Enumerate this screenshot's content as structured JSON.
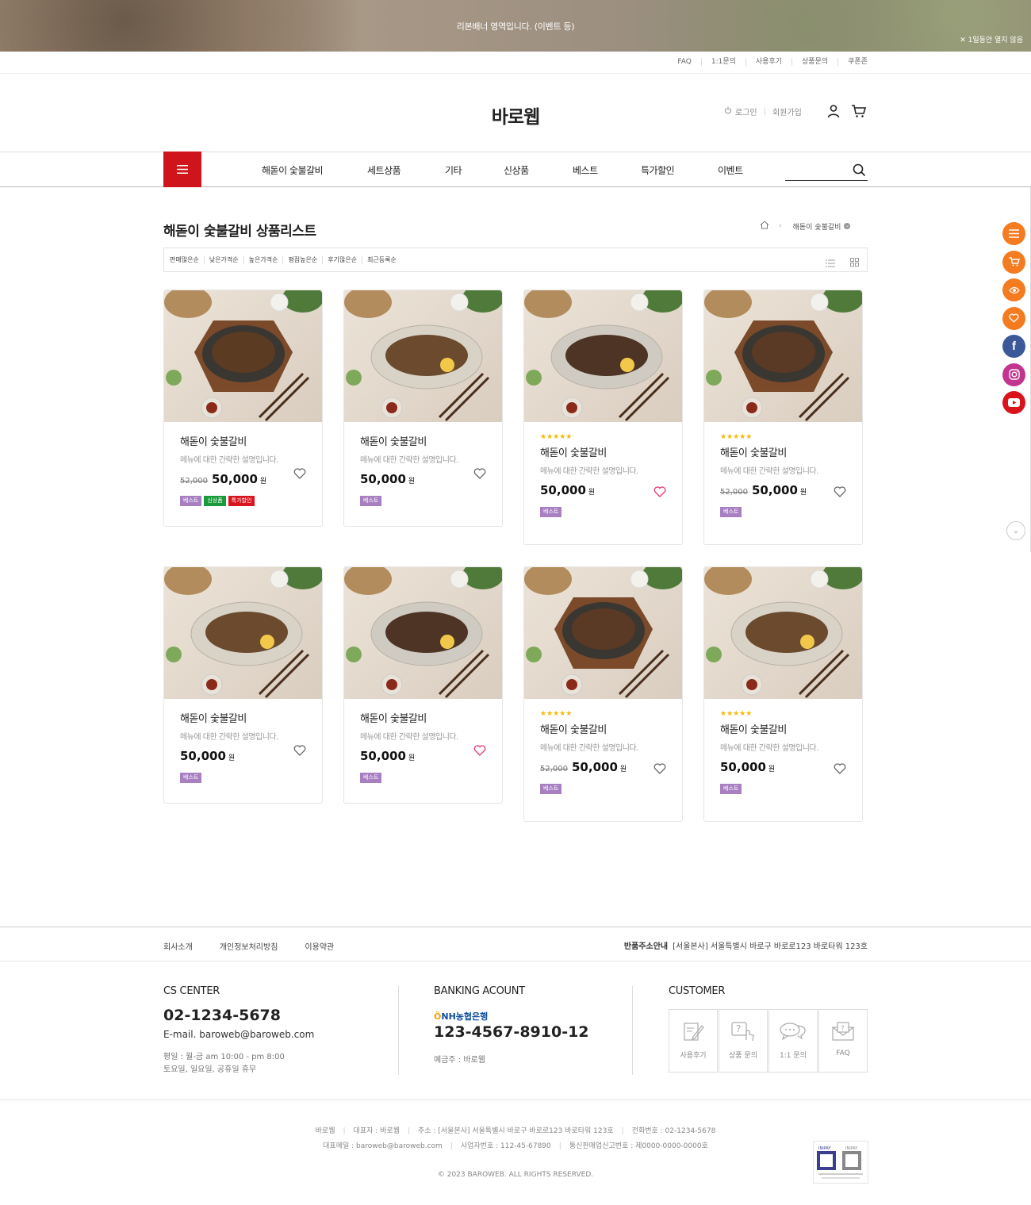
{
  "ribbon": {
    "text": "리본배너 영역입니다. (이벤트 등)",
    "close": "✕ 1일동안 열지 않음"
  },
  "toplinks": [
    "FAQ",
    "1:1문의",
    "사용후기",
    "상품문의",
    "쿠폰존"
  ],
  "header": {
    "logo": "바로웹",
    "login": "로그인",
    "join": "회원가입",
    "user_icon": "user-icon",
    "cart_icon": "cart-icon"
  },
  "nav": {
    "items": [
      "해돋이 숯불갈비",
      "세트상품",
      "기타",
      "신상품",
      "베스트",
      "특가할인",
      "이벤트"
    ],
    "accent": "#d0141c"
  },
  "page": {
    "title": "해돋이 숯불갈비 상품리스트",
    "breadcrumb_current": "해돋이 숯불갈비"
  },
  "sort": [
    "판매많은순",
    "낮은가격순",
    "높은가격순",
    "평점높은순",
    "후기많은순",
    "최근등록순"
  ],
  "products": [
    {
      "name": "해돋이 숯불갈비",
      "desc": "메뉴에 대한 간략한 설명입니다.",
      "old_price": "52,000",
      "price": "50,000",
      "won": "원",
      "stars": "",
      "liked": false,
      "badges": [
        "베스트",
        "신상품",
        "특가할인"
      ]
    },
    {
      "name": "해돋이 숯불갈비",
      "desc": "메뉴에 대한 간략한 설명입니다.",
      "old_price": "",
      "price": "50,000",
      "won": "원",
      "stars": "",
      "liked": false,
      "badges": [
        "베스트"
      ]
    },
    {
      "name": "해돋이 숯불갈비",
      "desc": "메뉴에 대한 간략한 설명입니다.",
      "old_price": "",
      "price": "50,000",
      "won": "원",
      "stars": "★★★★★",
      "liked": true,
      "badges": [
        "베스트"
      ]
    },
    {
      "name": "해돋이 숯불갈비",
      "desc": "메뉴에 대한 간략한 설명입니다.",
      "old_price": "52,000",
      "price": "50,000",
      "won": "원",
      "stars": "★★★★★",
      "liked": false,
      "badges": [
        "베스트"
      ]
    },
    {
      "name": "해돋이 숯불갈비",
      "desc": "메뉴에 대한 간략한 설명입니다.",
      "old_price": "",
      "price": "50,000",
      "won": "원",
      "stars": "",
      "liked": false,
      "badges": [
        "베스트"
      ]
    },
    {
      "name": "해돋이 숯불갈비",
      "desc": "메뉴에 대한 간략한 설명입니다.",
      "old_price": "",
      "price": "50,000",
      "won": "원",
      "stars": "",
      "liked": true,
      "badges": [
        "베스트"
      ]
    },
    {
      "name": "해돋이 숯불갈비",
      "desc": "메뉴에 대한 간략한 설명입니다.",
      "old_price": "52,000",
      "price": "50,000",
      "won": "원",
      "stars": "★★★★★",
      "liked": false,
      "badges": [
        "베스트"
      ]
    },
    {
      "name": "해돋이 숯불갈비",
      "desc": "메뉴에 대한 간략한 설명입니다.",
      "old_price": "",
      "price": "50,000",
      "won": "원",
      "stars": "★★★★★",
      "liked": false,
      "badges": [
        "베스트"
      ]
    }
  ],
  "quick": [
    {
      "icon": "list-icon",
      "color": "#f47b20"
    },
    {
      "icon": "cart-icon",
      "color": "#f47b20"
    },
    {
      "icon": "eye-icon",
      "color": "#f47b20"
    },
    {
      "icon": "heart-icon",
      "color": "#f47b20"
    },
    {
      "icon": "facebook-icon",
      "color": "#3b5998"
    },
    {
      "icon": "instagram-icon",
      "color": "#c1358e"
    },
    {
      "icon": "youtube-icon",
      "color": "#d9141c"
    }
  ],
  "footer": {
    "links": [
      "회사소개",
      "개인정보처리방침",
      "이용약관"
    ],
    "return_label": "반품주소안내",
    "return_addr": "[서울본사] 서울특별시 바로구 바로로123 바로타워 123호",
    "cs_title": "CS CENTER",
    "cs_phone": "02-1234-5678",
    "cs_mail": "E-mail. baroweb@baroweb.com",
    "cs_hours1": "평일 : 월-금 am 10:00 - pm 8:00",
    "cs_hours2": "토요일, 일요일, 공휴일 휴무",
    "bank_title": "BANKING ACOUNT",
    "bank_name": "NH농협은행",
    "bank_account": "123-4567-8910-12",
    "bank_owner": "예금주 : 바로웹",
    "customer_title": "CUSTOMER",
    "customer": [
      "사용후기",
      "상품 문의",
      "1:1 문의",
      "FAQ"
    ],
    "info1": [
      "바로웹",
      "대표자 : 바로웹",
      "주소 : [서울본사] 서울특별시 바로구 바로로123 바로타워 123호",
      "전화번호 : 02-1234-5678"
    ],
    "info2": [
      "대표메일 : baroweb@baroweb.com",
      "사업자번호 : 112-45-67890",
      "통신판매업신고번호 : 제0000-0000-0000호"
    ],
    "copyright": "© 2023 BAROWEB. ALL RIGHTS RESERVED.",
    "inipay": "INIPAY"
  }
}
